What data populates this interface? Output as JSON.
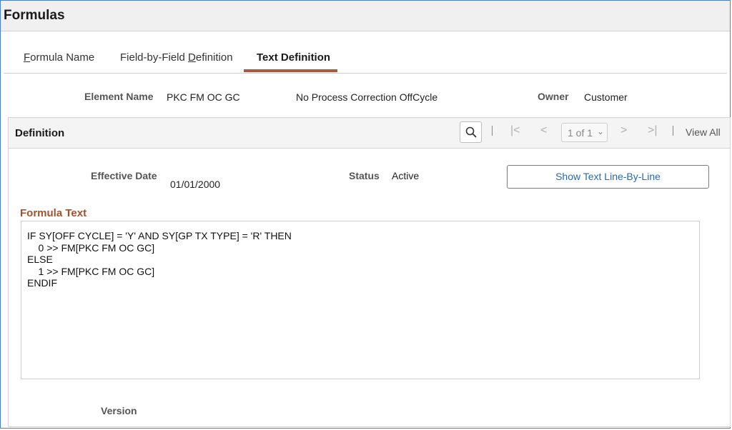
{
  "page": {
    "title": "Formulas"
  },
  "tabs": [
    {
      "pre": "",
      "u": "F",
      "post": "ormula Name"
    },
    {
      "pre": "Field-by-Field ",
      "u": "D",
      "post": "efinition"
    },
    {
      "pre": "Text Definition",
      "u": "",
      "post": ""
    }
  ],
  "element": {
    "name_label": "Element Name",
    "name_value": "PKC FM OC GC",
    "description": "No Process Correction OffCycle",
    "owner_label": "Owner",
    "owner_value": "Customer"
  },
  "definition": {
    "title": "Definition",
    "pager": "1 of 1",
    "view_all": "View All",
    "effective_date_label": "Effective Date",
    "effective_date": "01/01/2000",
    "status_label": "Status",
    "status": "Active",
    "show_button": "Show Text Line-By-Line",
    "formula_label": "Formula Text",
    "formula_lines": [
      "IF SY[OFF CYCLE] = 'Y' AND SY[GP TX TYPE] = 'R' THEN",
      "    0 >> FM[PKC FM OC GC]",
      "ELSE",
      "    1 >> FM[PKC FM OC GC]",
      "ENDIF"
    ],
    "version_label": "Version"
  },
  "icons": {
    "search": "search-icon",
    "first": "first-page-icon",
    "prev": "previous-icon",
    "next": "next-icon",
    "last": "last-page-icon",
    "dropdown": "chevron-down-icon"
  },
  "colors": {
    "accent": "#a85a3a",
    "link": "#2a6aa8",
    "formula_label": "#a0522d"
  }
}
